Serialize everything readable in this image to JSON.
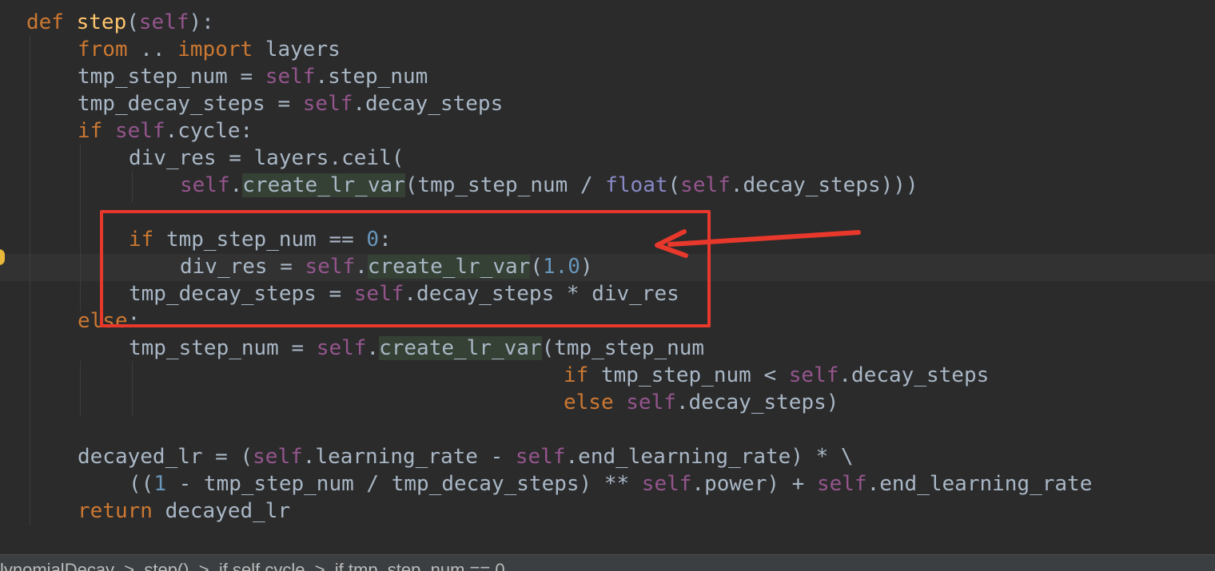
{
  "status_bar": {
    "text": "lynomialDecay  >  step()  >  if self.cycle  >  if tmp_step_num == 0"
  },
  "code_lines": [
    [
      [
        "def ",
        "kw"
      ],
      [
        "step",
        "fn"
      ],
      [
        "(",
        "id"
      ],
      [
        "self",
        "self"
      ],
      [
        "):",
        "id"
      ]
    ],
    [
      [
        "from",
        "kw"
      ],
      [
        " .. ",
        "id"
      ],
      [
        "import",
        "kw"
      ],
      [
        " layers",
        "id"
      ]
    ],
    [
      [
        "tmp_step_num = ",
        "id"
      ],
      [
        "self",
        "self"
      ],
      [
        ".step_num",
        "id"
      ]
    ],
    [
      [
        "tmp_decay_steps = ",
        "id"
      ],
      [
        "self",
        "self"
      ],
      [
        ".decay_steps",
        "id"
      ]
    ],
    [
      [
        "if ",
        "kw"
      ],
      [
        "self",
        "self"
      ],
      [
        ".cycle:",
        "id"
      ]
    ],
    [
      [
        "div_res = layers.ceil(",
        "id"
      ]
    ],
    [
      [
        "self",
        "self"
      ],
      [
        ".",
        "id"
      ],
      [
        "create_lr_var",
        "hl"
      ],
      [
        "(tmp_step_num / ",
        "id"
      ],
      [
        "float",
        "bi"
      ],
      [
        "(",
        "id"
      ],
      [
        "self",
        "self"
      ],
      [
        ".decay_steps)))",
        "id"
      ]
    ],
    [],
    [
      [
        "if ",
        "kw"
      ],
      [
        "tmp_step_num == ",
        "id"
      ],
      [
        "0",
        "num"
      ],
      [
        ":",
        "id"
      ]
    ],
    [
      [
        "div_res = ",
        "id"
      ],
      [
        "self",
        "self"
      ],
      [
        ".",
        "id"
      ],
      [
        "create_lr_var",
        "hl"
      ],
      [
        "(",
        "id"
      ],
      [
        "1.0",
        "num"
      ],
      [
        ")",
        "id"
      ]
    ],
    [
      [
        "tmp_decay_steps = ",
        "id"
      ],
      [
        "self",
        "self"
      ],
      [
        ".decay_steps * div_res",
        "id"
      ]
    ],
    [
      [
        "else",
        "kw"
      ],
      [
        ":",
        "id"
      ]
    ],
    [
      [
        "tmp_step_num = ",
        "id"
      ],
      [
        "self",
        "self"
      ],
      [
        ".",
        "id"
      ],
      [
        "create_lr_var",
        "hl"
      ],
      [
        "(tmp_step_num",
        "id"
      ]
    ],
    [
      [
        "if ",
        "kw"
      ],
      [
        "tmp_step_num < ",
        "id"
      ],
      [
        "self",
        "self"
      ],
      [
        ".decay_steps",
        "id"
      ]
    ],
    [
      [
        "else ",
        "kw"
      ],
      [
        "self",
        "self"
      ],
      [
        ".decay_steps)",
        "id"
      ]
    ],
    [],
    [
      [
        "decayed_lr = (",
        "id"
      ],
      [
        "self",
        "self"
      ],
      [
        ".learning_rate - ",
        "id"
      ],
      [
        "self",
        "self"
      ],
      [
        ".end_learning_rate) * \\",
        "id"
      ]
    ],
    [
      [
        "((",
        "id"
      ],
      [
        "1",
        "num"
      ],
      [
        " - tmp_step_num / tmp_decay_steps) ** ",
        "id"
      ],
      [
        "self",
        "self"
      ],
      [
        ".power) + ",
        "id"
      ],
      [
        "self",
        "self"
      ],
      [
        ".end_learning_rate",
        "id"
      ]
    ],
    [
      [
        "return ",
        "kw"
      ],
      [
        "decayed_lr",
        "id"
      ]
    ]
  ],
  "colors": {
    "background": "#2b2b2b",
    "keyword": "#cc7832",
    "function_name": "#ffc66d",
    "self": "#94558d",
    "number": "#6897bb",
    "builtin": "#8888c6",
    "identifier": "#a9b7c6",
    "usage_highlight": "#344134",
    "annotation": "#e8382c"
  }
}
